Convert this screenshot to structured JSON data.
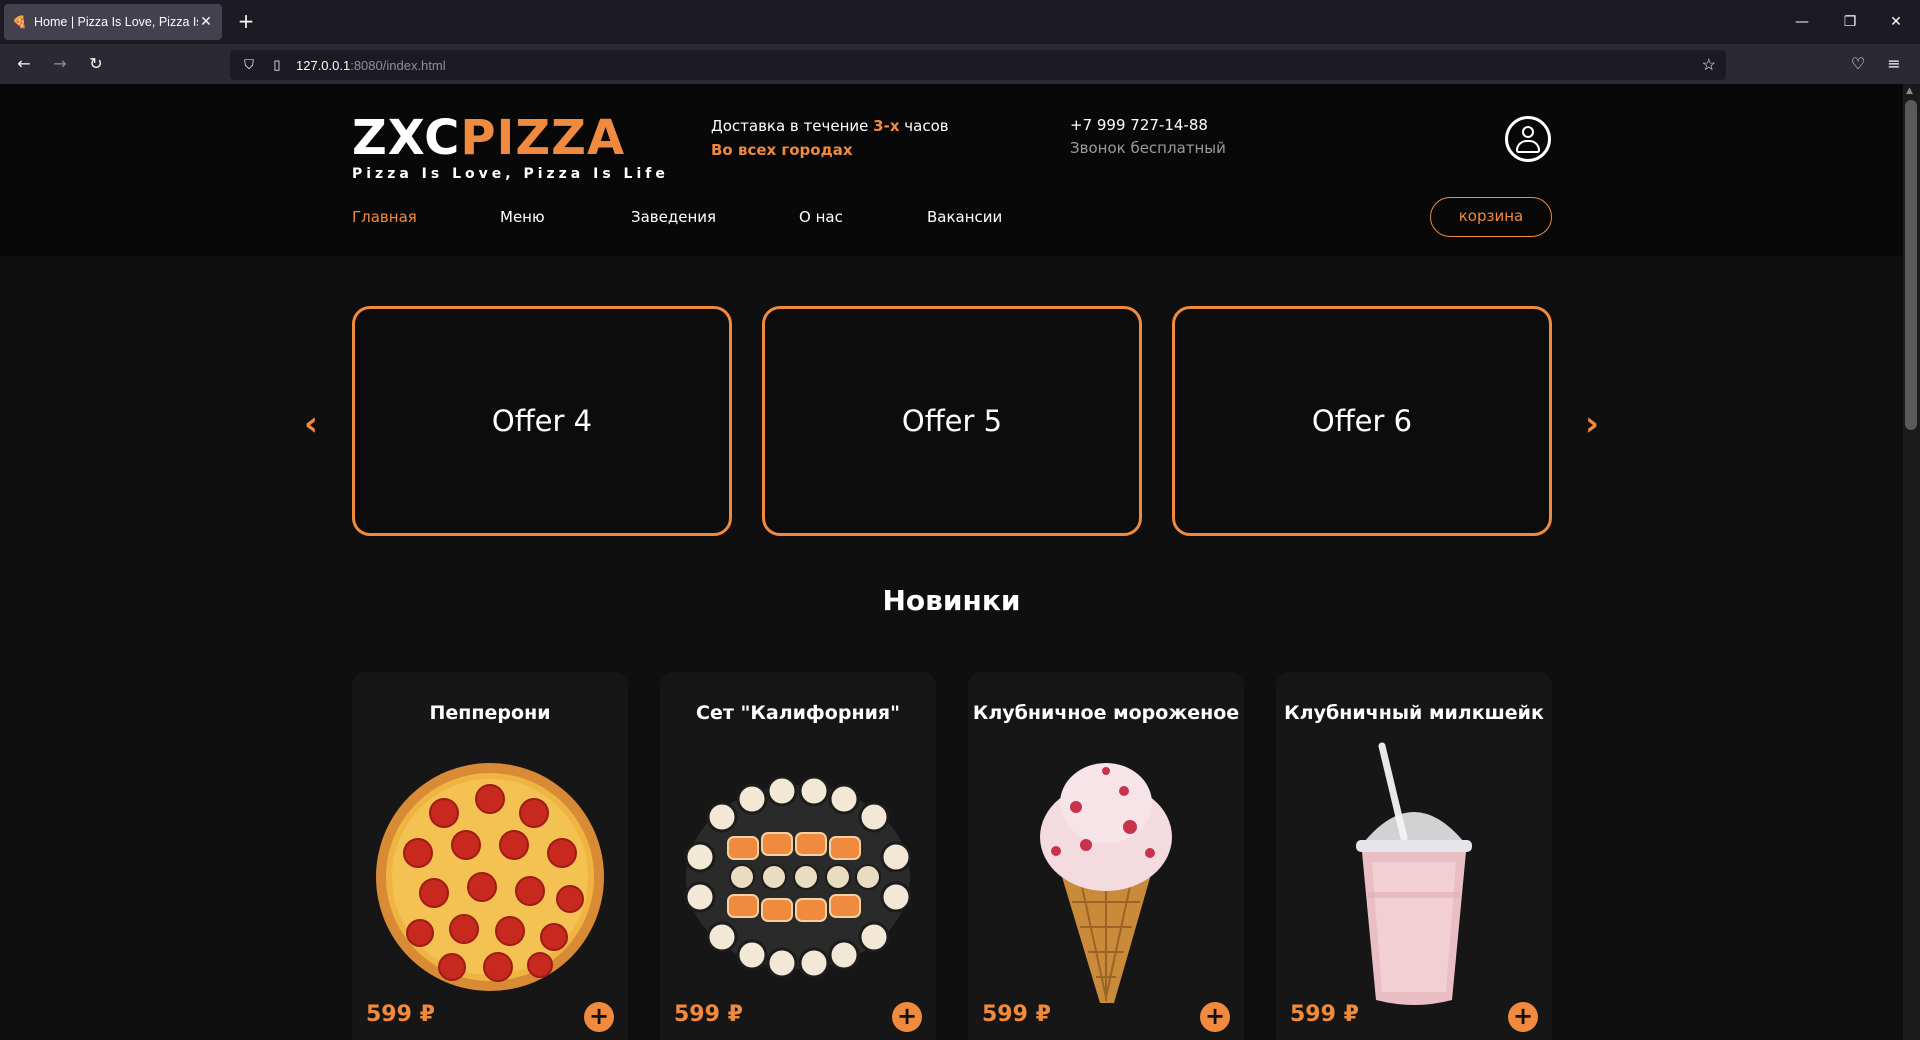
{
  "browser": {
    "tab_title": "Home | Pizza Is Love, Pizza Is Life",
    "url_host": "127.0.0.1",
    "url_path": ":8080/index.html"
  },
  "header": {
    "logo_zxc": "ZXC",
    "logo_pizza": "PIZZA",
    "slogan": "Pizza Is Love, Pizza Is Life",
    "delivery_prefix": "Доставка в течение ",
    "delivery_hours": "3-х",
    "delivery_suffix": " часов",
    "delivery_cities": "Во всех городах",
    "phone": "+7 999 727-14-88",
    "phone_note": "Звонок бесплатный",
    "cart_label": "корзина"
  },
  "menu": [
    {
      "label": "Главная",
      "active": true
    },
    {
      "label": "Меню",
      "active": false
    },
    {
      "label": "Заведения",
      "active": false
    },
    {
      "label": "О нас",
      "active": false
    },
    {
      "label": "Вакансии",
      "active": false
    }
  ],
  "slider": {
    "offers": [
      "Offer 4",
      "Offer 5",
      "Offer 6"
    ],
    "prev_icon": "‹",
    "next_icon": "›"
  },
  "section_title": "Новинки",
  "products": [
    {
      "name": "Пепперони",
      "price": "599 ₽",
      "image": "pepperoni-pizza"
    },
    {
      "name": "Сет \"Калифорния\"",
      "price": "599 ₽",
      "image": "sushi-set"
    },
    {
      "name": "Клубничное мороженое",
      "price": "599 ₽",
      "image": "strawberry-ice-cream-cone"
    },
    {
      "name": "Клубничный милкшейк",
      "price": "599 ₽",
      "image": "strawberry-milkshake"
    }
  ],
  "colors": {
    "accent": "#f08a3e",
    "background": "#0f0f0f",
    "header_bg": "#080808",
    "card_bg": "#161616"
  }
}
